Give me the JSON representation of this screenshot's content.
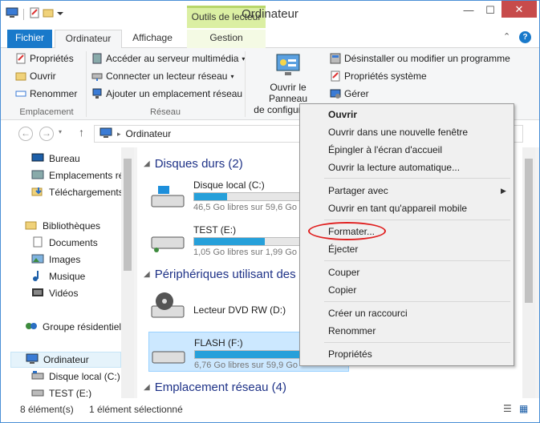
{
  "window": {
    "title": "Ordinateur",
    "context_tab_group": "Outils de lecteur"
  },
  "tabs": [
    {
      "label": "Fichier"
    },
    {
      "label": "Ordinateur"
    },
    {
      "label": "Affichage"
    },
    {
      "label": "Gestion"
    }
  ],
  "ribbon": {
    "emplacement": {
      "label": "Emplacement",
      "items": [
        "Propriétés",
        "Ouvrir",
        "Renommer"
      ]
    },
    "reseau": {
      "label": "Réseau",
      "items": [
        "Accéder au serveur multimédia",
        "Connecter un lecteur réseau",
        "Ajouter un emplacement réseau"
      ]
    },
    "panneau": {
      "label": "Ouvrir le Panneau de configuration",
      "line1": "Ouvrir le Panneau",
      "line2": "de configuration"
    },
    "systeme": {
      "items": [
        "Désinstaller ou modifier un programme",
        "Propriétés système",
        "Gérer"
      ]
    }
  },
  "address": {
    "path": "Ordinateur"
  },
  "nav": {
    "items": [
      "Bureau",
      "Emplacements récents",
      "Téléchargements",
      "Bibliothèques",
      "Documents",
      "Images",
      "Musique",
      "Vidéos",
      "Groupe résidentiel",
      "Ordinateur",
      "Disque local (C:)",
      "TEST (E:)"
    ]
  },
  "content": {
    "groups": [
      {
        "title": "Disques durs (2)"
      },
      {
        "title": "Périphériques utilisant des s"
      },
      {
        "title": "Emplacement réseau (4)"
      }
    ],
    "drives": [
      {
        "name": "Disque local (C:)",
        "free": "46,5 Go libres sur 59,6 Go",
        "used_fraction": 0.22
      },
      {
        "name": "TEST (E:)",
        "free": "1,05 Go libres sur 1,99 Go",
        "used_fraction": 0.47
      },
      {
        "name": "Lecteur DVD RW (D:)"
      },
      {
        "name": "FLASH (F:)",
        "free": "6,76 Go libres sur 59,9 Go",
        "used_fraction": 0.89
      }
    ]
  },
  "status": {
    "count": "8 élément(s)",
    "selection": "1 élément sélectionné"
  },
  "context_menu": {
    "items": [
      "Ouvrir",
      "Ouvrir dans une nouvelle fenêtre",
      "Épingler à l'écran d'accueil",
      "Ouvrir la lecture automatique...",
      "Partager avec",
      "Ouvrir en tant qu'appareil mobile",
      "Formater...",
      "Éjecter",
      "Couper",
      "Copier",
      "Créer un raccourci",
      "Renommer",
      "Propriétés"
    ]
  },
  "colors": {
    "accent": "#1979ca",
    "highlight": "#e02020",
    "group_title": "#1e3287"
  }
}
